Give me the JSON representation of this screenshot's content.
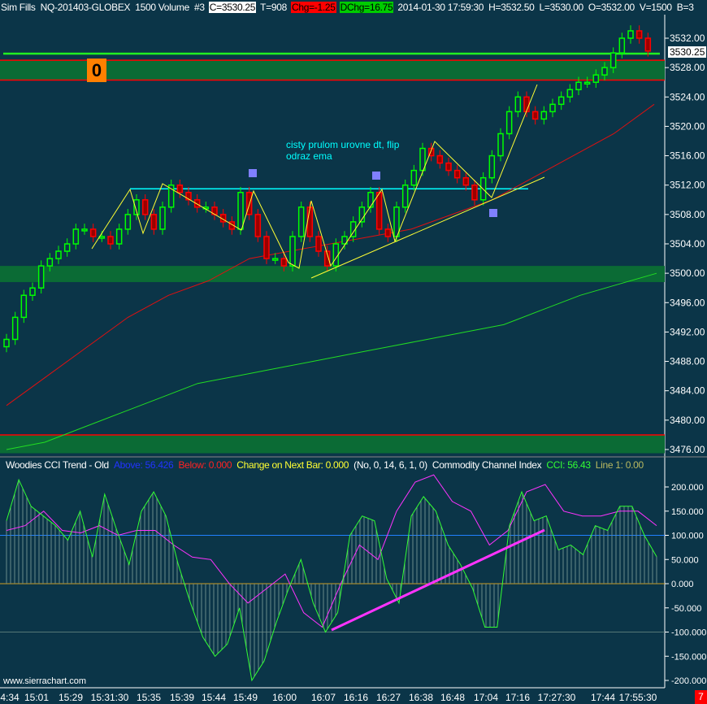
{
  "header": {
    "account": "Sim Fills",
    "symbol": "NQ-201403-GLOBEX",
    "bar_type": "1500 Volume",
    "chart_num": "#3",
    "close": "C=3530.25",
    "trades": "T=908",
    "chg": "Chg=-1.25",
    "dchg": "DChg=16.75",
    "datetime": "2014-01-30 17:59:30",
    "high": "H=3532.50",
    "low": "L=3530.00",
    "open": "O=3532.00",
    "volume": "V=1500",
    "extra": "B=3"
  },
  "cci_header": {
    "study": "Woodies CCI Trend - Old",
    "above": "Above: 56.426",
    "below": "Below: 0.000",
    "change": "Change on Next Bar: 0.000",
    "params": "(No, 0, 14, 6, 1, 0)",
    "cci_name": "Commodity Channel Index",
    "cci_val": "CCI: 56.43",
    "line1": "Line 1: 0.00"
  },
  "annotation": {
    "text_line1": "cisty prulom urovne dt, flip",
    "text_line2": "odraz ema",
    "zone_label": "0"
  },
  "watermark": "www.sierrachart.com",
  "last_price_label": "3530.25",
  "corner_badge": "7",
  "colors": {
    "bg": "#0b3548",
    "up": "#00ff00",
    "down": "#ff0000",
    "ema": "#e01010",
    "sma": "#22dd22",
    "zone": "#0b6b35",
    "cci": "#33ff33",
    "tcci": "#ff33ff",
    "zigzag": "#ffff33",
    "cyan": "#00ffff"
  },
  "chart_data": [
    {
      "type": "candlestick",
      "title": "NQ-201403-GLOBEX 1500 Volume",
      "ylim": [
        3474,
        3535
      ],
      "y_ticks": [
        "3532.00",
        "3528.00",
        "3524.00",
        "3520.00",
        "3516.00",
        "3512.00",
        "3508.00",
        "3504.00",
        "3500.00",
        "3496.00",
        "3492.00",
        "3488.00",
        "3484.00",
        "3480.00",
        "3476.00"
      ],
      "x_ticks": [
        "4:34",
        "15:01",
        "15:29",
        "15:31:30",
        "15:35",
        "15:39",
        "15:44",
        "15:49",
        "16:00",
        "16:07",
        "16:16",
        "16:27",
        "16:38",
        "16:48",
        "17:04",
        "17:16",
        "17:27:30",
        "17:44",
        "17:55:30"
      ],
      "closes": [
        3491,
        3494,
        3497,
        3498,
        3501,
        3502,
        3503,
        3504,
        3506,
        3506,
        3505,
        3505,
        3504,
        3506,
        3508,
        3510,
        3508,
        3506,
        3509,
        3512,
        3511,
        3510,
        3509,
        3509,
        3508,
        3507,
        3506,
        3511,
        3508,
        3505,
        3502,
        3502,
        3501,
        3505,
        3509,
        3505,
        3503,
        3501,
        3504,
        3505,
        3507,
        3509,
        3511,
        3506,
        3505,
        3509,
        3512,
        3514,
        3517,
        3516,
        3515,
        3514,
        3513,
        3512,
        3510,
        3513,
        3516,
        3519,
        3522,
        3524,
        3522,
        3521,
        3522,
        3523,
        3524,
        3525,
        3526,
        3526,
        3527,
        3528,
        3530,
        3532,
        3533,
        3532,
        3530.25
      ],
      "ema": [
        3482,
        3486,
        3490,
        3494,
        3497,
        3499,
        3502,
        3503,
        3504,
        3505,
        3506,
        3508,
        3510,
        3513,
        3516,
        3519,
        3523
      ],
      "sma": [
        3476,
        3477,
        3479,
        3481,
        3483,
        3485,
        3486,
        3487,
        3488,
        3489,
        3490,
        3491,
        3492,
        3493,
        3495,
        3497,
        3498.5,
        3500
      ],
      "zones": [
        {
          "top": 3529,
          "bottom": 3526.3
        },
        {
          "top": 3501,
          "bottom": 3498.8
        },
        {
          "top": 3478,
          "bottom": 3475.5
        }
      ],
      "level_line": 3529.9,
      "cyan_level": 3511.5
    },
    {
      "type": "line",
      "title": "Woodies CCI Trend - Old",
      "ylim": [
        -215,
        230
      ],
      "y_ticks": [
        "200.000",
        "150.000",
        "100.000",
        "50.000",
        "0.000",
        "-50.000",
        "-100.000",
        "-150.000",
        "-200.000"
      ],
      "cci": [
        130,
        215,
        160,
        140,
        120,
        90,
        150,
        55,
        185,
        110,
        40,
        150,
        190,
        140,
        40,
        -40,
        -110,
        -150,
        -125,
        -50,
        -200,
        -160,
        -80,
        -10,
        50,
        -40,
        -100,
        -60,
        100,
        140,
        130,
        10,
        -40,
        140,
        180,
        150,
        80,
        40,
        -10,
        -90,
        -90,
        120,
        190,
        130,
        140,
        70,
        80,
        60,
        120,
        110,
        160,
        160,
        100,
        56
      ],
      "tcci": [
        110,
        120,
        150,
        110,
        105,
        120,
        100,
        110,
        110,
        80,
        55,
        50,
        0,
        -40,
        -10,
        20,
        -60,
        -90,
        0,
        80,
        50,
        150,
        210,
        225,
        170,
        150,
        80,
        110,
        190,
        205,
        150,
        140,
        140,
        150,
        150,
        120
      ],
      "levels": [
        100,
        0,
        -100
      ]
    }
  ]
}
